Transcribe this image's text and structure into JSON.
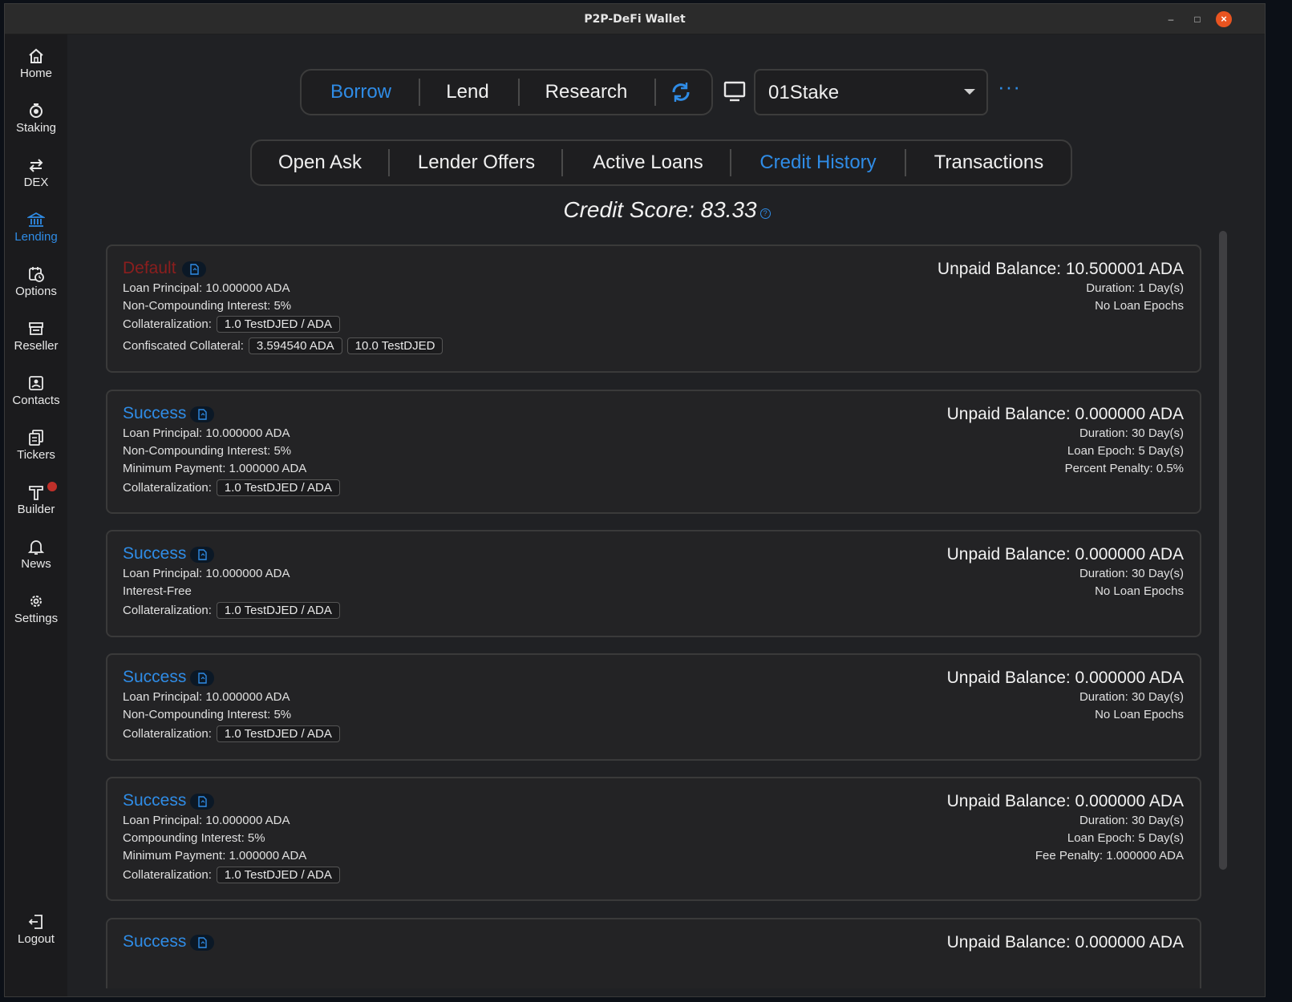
{
  "window": {
    "title": "P2P-DeFi Wallet",
    "minimize": "–",
    "maximize": "□",
    "close": "×"
  },
  "sidebar": {
    "items": [
      {
        "label": "Home"
      },
      {
        "label": "Staking"
      },
      {
        "label": "DEX"
      },
      {
        "label": "Lending"
      },
      {
        "label": "Options"
      },
      {
        "label": "Reseller"
      },
      {
        "label": "Contacts"
      },
      {
        "label": "Tickers"
      },
      {
        "label": "Builder"
      },
      {
        "label": "News"
      },
      {
        "label": "Settings"
      }
    ],
    "logout": "Logout",
    "active_color": "#2f8ce6",
    "badge_color": "#c0302a"
  },
  "top_tabs": {
    "borrow": "Borrow",
    "lend": "Lend",
    "research": "Research",
    "active": "Borrow"
  },
  "wallet_select": {
    "value": "01Stake"
  },
  "more": "···",
  "sub_tabs": {
    "open_ask": "Open Ask",
    "lender_offers": "Lender Offers",
    "active_loans": "Active Loans",
    "credit_history": "Credit History",
    "transactions": "Transactions",
    "active": "Credit History"
  },
  "credit_score": {
    "text": "Credit Score: 83.33",
    "help": "?"
  },
  "loans": [
    {
      "status": "Default",
      "principal": "Loan Principal: 10.000000 ADA",
      "interest": "Non-Compounding Interest: 5%",
      "collateral_label": "Collateralization:",
      "collateral": "1.0 TestDJED / ADA",
      "confiscated_label": "Confiscated Collateral:",
      "confiscated": [
        "3.594540 ADA",
        "10.0 TestDJED"
      ],
      "unpaid": "Unpaid Balance: 10.500001 ADA",
      "duration": "Duration: 1 Day(s)",
      "epochs": "No Loan Epochs"
    },
    {
      "status": "Success",
      "principal": "Loan Principal: 10.000000 ADA",
      "interest": "Non-Compounding Interest: 5%",
      "min_payment": "Minimum Payment: 1.000000 ADA",
      "collateral_label": "Collateralization:",
      "collateral": "1.0 TestDJED / ADA",
      "unpaid": "Unpaid Balance: 0.000000 ADA",
      "duration": "Duration: 30 Day(s)",
      "epochs": "Loan Epoch: 5 Day(s)",
      "penalty": "Percent Penalty: 0.5%"
    },
    {
      "status": "Success",
      "principal": "Loan Principal: 10.000000 ADA",
      "interest": "Interest-Free",
      "collateral_label": "Collateralization:",
      "collateral": "1.0 TestDJED / ADA",
      "unpaid": "Unpaid Balance: 0.000000 ADA",
      "duration": "Duration: 30 Day(s)",
      "epochs": "No Loan Epochs"
    },
    {
      "status": "Success",
      "principal": "Loan Principal: 10.000000 ADA",
      "interest": "Non-Compounding Interest: 5%",
      "collateral_label": "Collateralization:",
      "collateral": "1.0 TestDJED / ADA",
      "unpaid": "Unpaid Balance: 0.000000 ADA",
      "duration": "Duration: 30 Day(s)",
      "epochs": "No Loan Epochs"
    },
    {
      "status": "Success",
      "principal": "Loan Principal: 10.000000 ADA",
      "interest": "Compounding Interest: 5%",
      "min_payment": "Minimum Payment: 1.000000 ADA",
      "collateral_label": "Collateralization:",
      "collateral": "1.0 TestDJED / ADA",
      "unpaid": "Unpaid Balance: 0.000000 ADA",
      "duration": "Duration: 30 Day(s)",
      "epochs": "Loan Epoch: 5 Day(s)",
      "penalty": "Fee Penalty: 1.000000 ADA"
    },
    {
      "status": "Success",
      "unpaid": "Unpaid Balance: 0.000000 ADA"
    }
  ]
}
